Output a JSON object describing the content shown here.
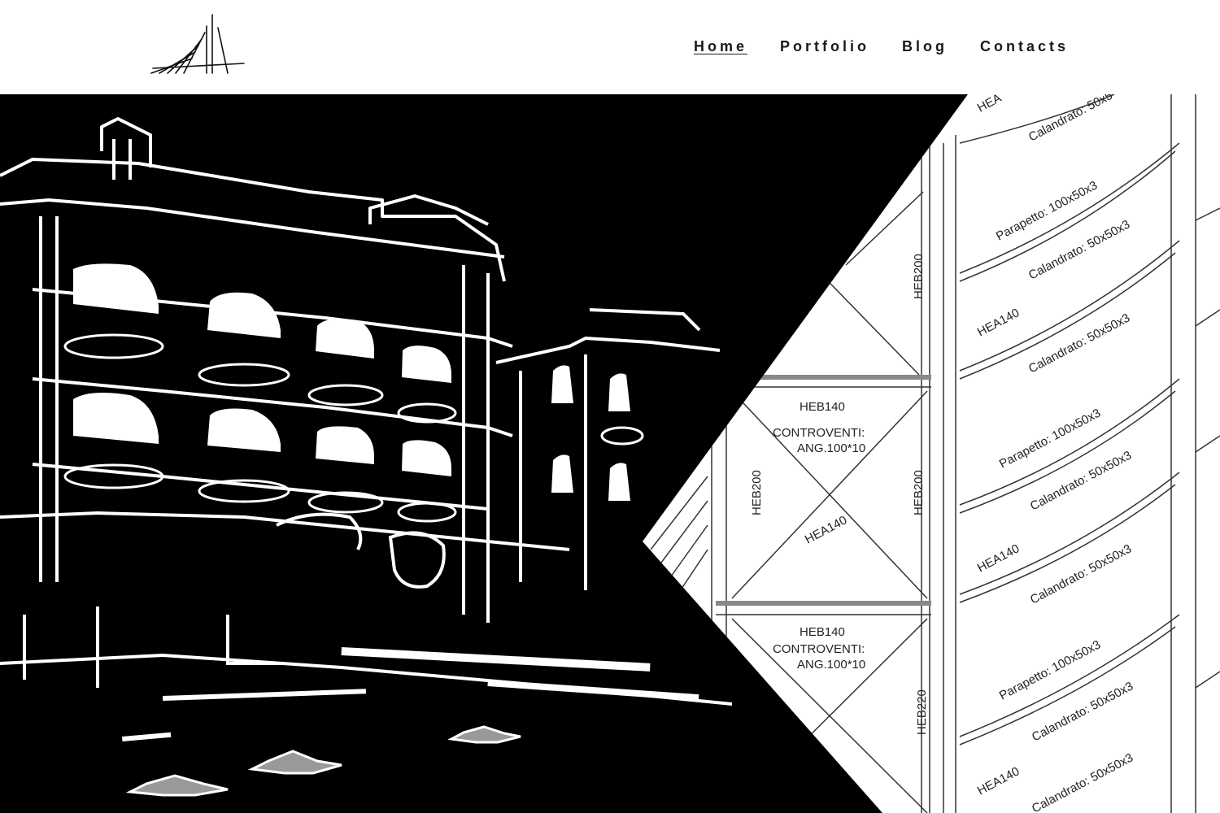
{
  "nav": {
    "items": [
      {
        "label": "Home",
        "active": true
      },
      {
        "label": "Portfolio",
        "active": false
      },
      {
        "label": "Blog",
        "active": false
      },
      {
        "label": "Contacts",
        "active": false
      }
    ]
  },
  "hero": {
    "drawing_labels": {
      "hea_top": "HEA",
      "calandrato": "Calandrato: 50x50x3",
      "calandrato_top": "Calandrato: 50x5",
      "parapetto": "Parapetto: 100x50x3",
      "hea140": "HEA140",
      "heb200": "HEB200",
      "heb220": "HEB220",
      "heb140": "HEB140",
      "controventi": "CONTROVENTI:",
      "ang": "ANG.100*10"
    }
  },
  "colors": {
    "background": "#ffffff",
    "text": "#1a1a1a",
    "hero_dark": "#000000",
    "hero_light": "#ffffff"
  }
}
